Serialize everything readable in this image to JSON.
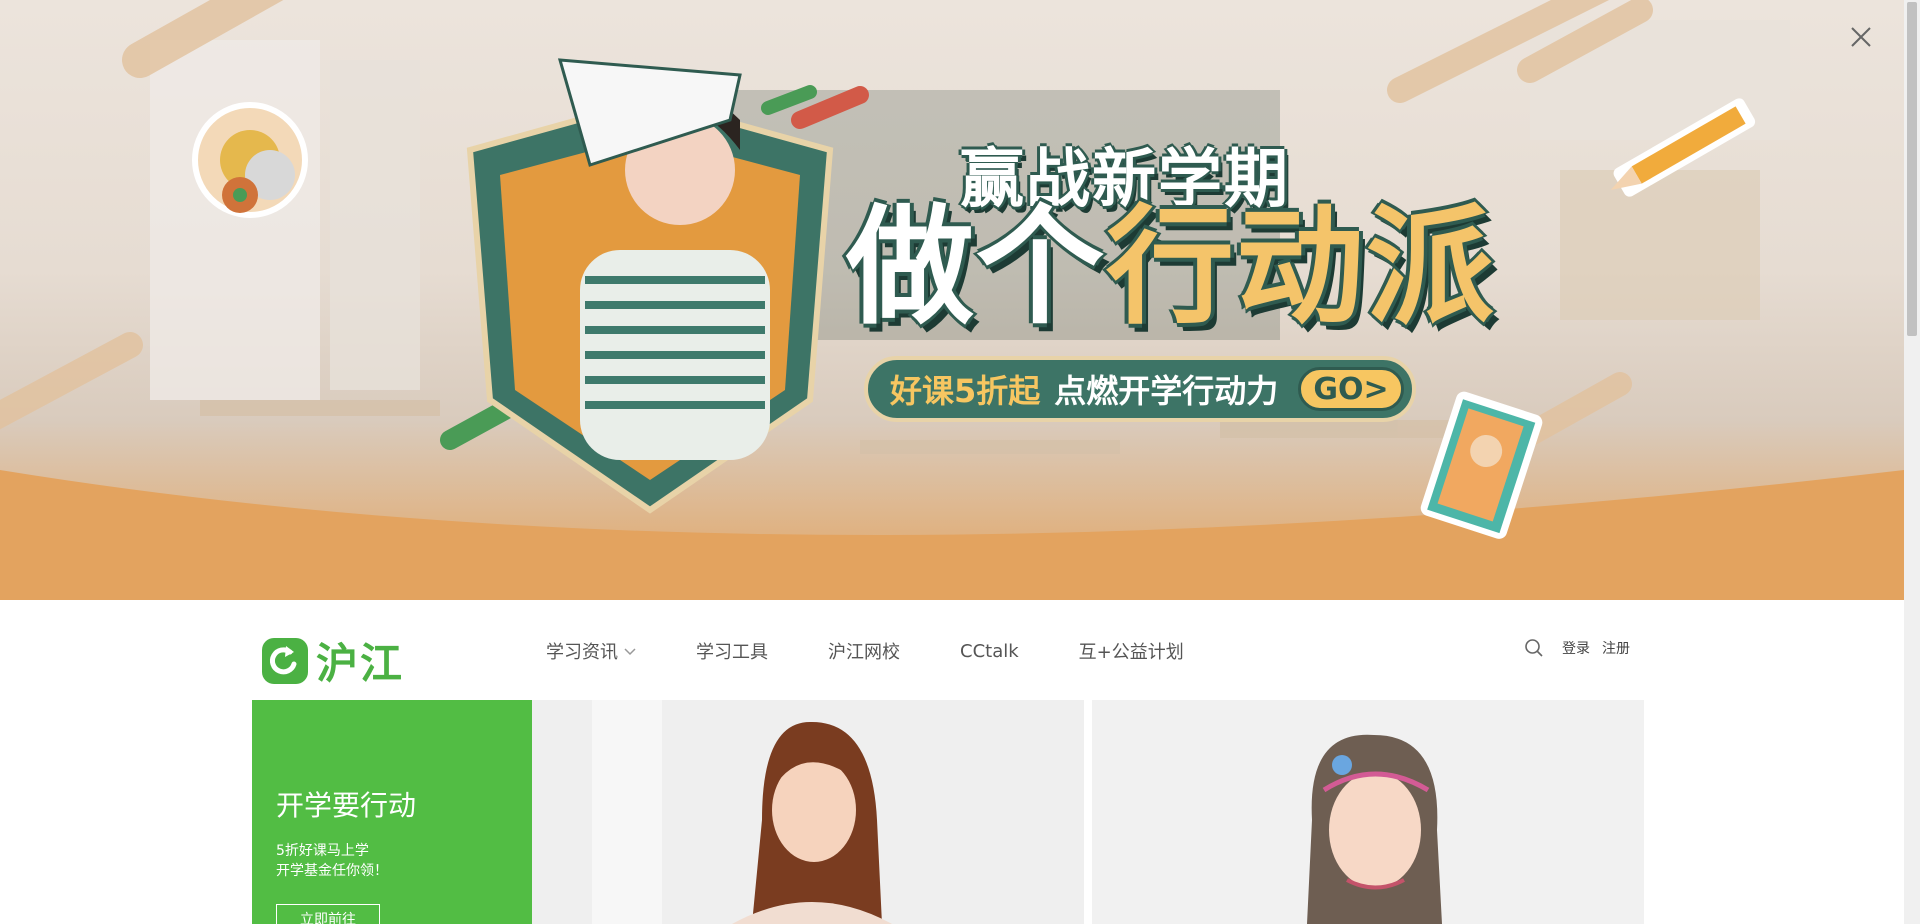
{
  "banner": {
    "headline_small": "赢战新学期",
    "headline_big_part1": "做个",
    "headline_big_part2": "行动派",
    "promo_highlight": "好课5折起",
    "promo_text": "点燃开学行动力",
    "go_label": "GO>",
    "close_icon": "close-icon"
  },
  "logo": {
    "text": "沪江",
    "icon": "hujiang-logo-icon"
  },
  "nav": {
    "items": [
      {
        "label": "学习资讯",
        "has_dropdown": true
      },
      {
        "label": "学习工具"
      },
      {
        "label": "沪江网校"
      },
      {
        "label": "CCtalk"
      },
      {
        "label": "互+公益计划"
      }
    ],
    "search_icon": "search-icon",
    "login": "登录",
    "register": "注册"
  },
  "feature_card": {
    "title": "开学要行动",
    "line1": "5折好课马上学",
    "line2": "开学基金任你领！",
    "button": "立即前往"
  },
  "colors": {
    "brand_green": "#52bd44",
    "banner_orange": "#e3a35f",
    "banner_teal": "#2f5b50",
    "banner_yellow": "#f4c46a"
  }
}
